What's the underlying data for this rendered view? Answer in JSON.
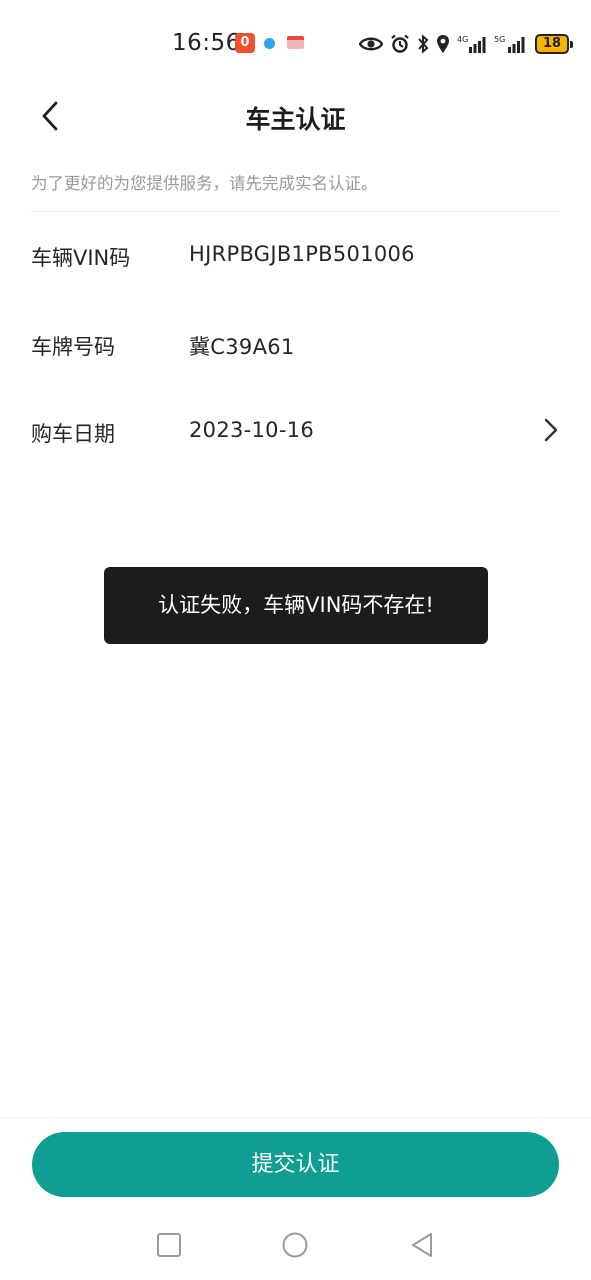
{
  "status_bar": {
    "time": "16:56",
    "notification_badge": "0",
    "battery_level": "18",
    "network_labels": [
      "4G",
      "5G"
    ],
    "colors": {
      "notification_red": "#f0502d",
      "notification_blue": "#2ea3f2",
      "battery_fill": "#f6b400"
    }
  },
  "header": {
    "title": "车主认证",
    "back_icon": "chevron-left-icon"
  },
  "notice": {
    "text": "为了更好的为您提供服务，请先完成实名认证。"
  },
  "form": {
    "rows": [
      {
        "label": "车辆VIN码",
        "value": "HJRPBGJB1PB501006",
        "has_chevron": false
      },
      {
        "label": "车牌号码",
        "value": "冀C39A61",
        "has_chevron": false
      },
      {
        "label": "购车日期",
        "value": "2023-10-16",
        "has_chevron": true
      }
    ]
  },
  "toast": {
    "message": "认证失败，车辆VIN码不存在!"
  },
  "submit": {
    "label": "提交认证",
    "color": "#0e9f92"
  },
  "nav_bar": {
    "icons": [
      "recent-apps-icon",
      "home-icon",
      "back-triangle-icon"
    ]
  }
}
